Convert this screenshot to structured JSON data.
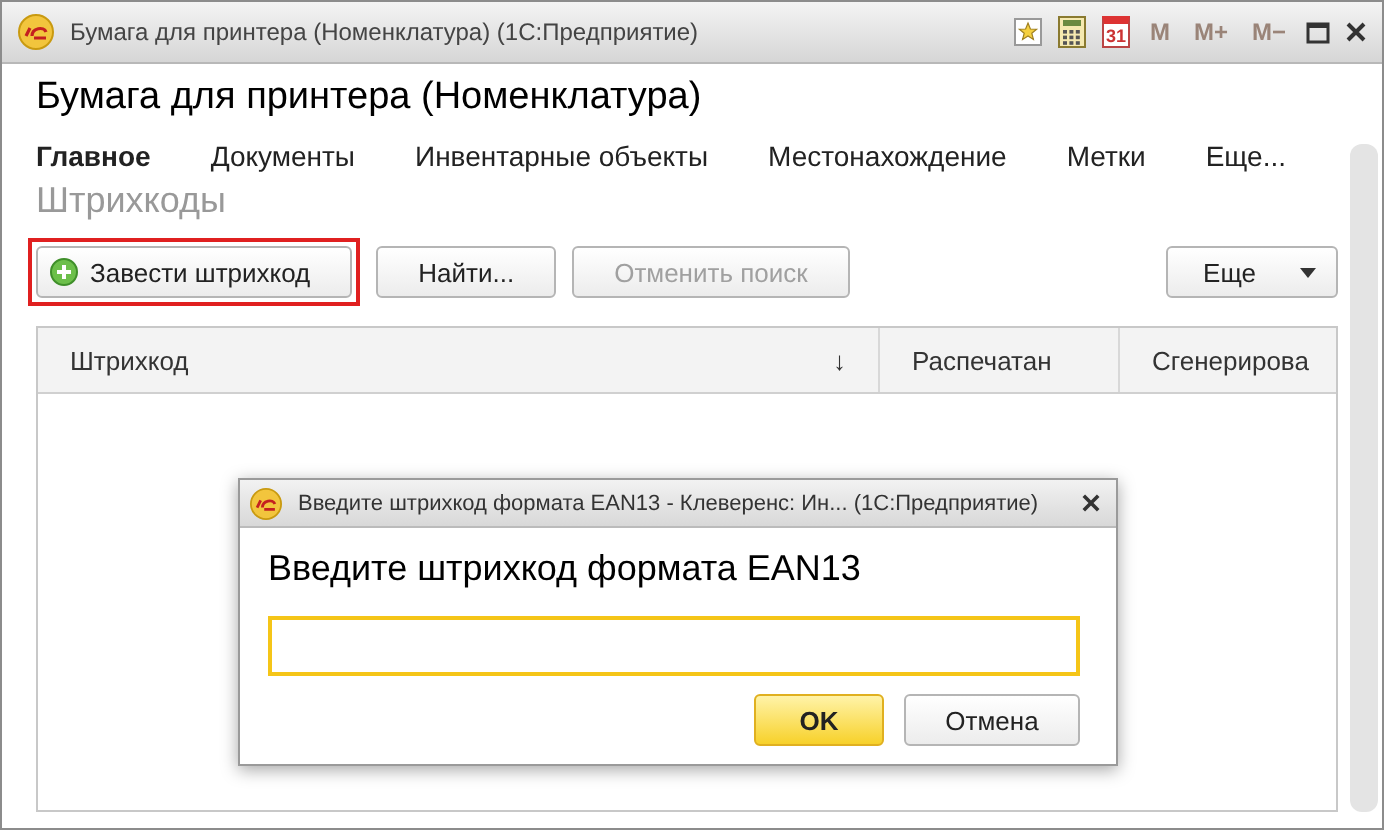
{
  "window": {
    "title": "Бумага для принтера (Номенклатура)  (1С:Предприятие)",
    "calendar_day": "31",
    "memory_buttons": [
      {
        "label": "M",
        "disabled": true
      },
      {
        "label": "M+",
        "disabled": true
      },
      {
        "label": "M−",
        "disabled": true
      }
    ]
  },
  "form_title": "Бумага для принтера (Номенклатура)",
  "tabs": [
    {
      "label": "Главное",
      "selected": true
    },
    {
      "label": "Документы",
      "selected": false
    },
    {
      "label": "Инвентарные объекты",
      "selected": false
    },
    {
      "label": "Местонахождение",
      "selected": false
    },
    {
      "label": "Метки",
      "selected": false
    },
    {
      "label": "Еще...",
      "selected": false
    }
  ],
  "section_title": "Штрихкоды",
  "toolbar": [
    {
      "kind": "add",
      "label": "Завести штрихкод",
      "disabled": false,
      "highlighted": true
    },
    {
      "kind": "plain",
      "label": "Найти...",
      "disabled": false,
      "highlighted": false
    },
    {
      "kind": "plain",
      "label": "Отменить поиск",
      "disabled": true,
      "highlighted": false
    },
    {
      "kind": "menu",
      "label": "Еще",
      "disabled": false,
      "highlighted": false
    }
  ],
  "table": {
    "columns": [
      {
        "label": "Штрихкод",
        "sort": "↓"
      },
      {
        "label": "Распечатан"
      },
      {
        "label": "Сгенерирова"
      }
    ]
  },
  "dialog": {
    "title": "Введите штрихкод формата EAN13 - Клеверенс: Ин...  (1С:Предприятие)",
    "prompt": "Введите штрихкод формата EAN13",
    "buttons": [
      {
        "label": "OK",
        "default": true
      },
      {
        "label": "Отмена",
        "default": false
      }
    ]
  }
}
